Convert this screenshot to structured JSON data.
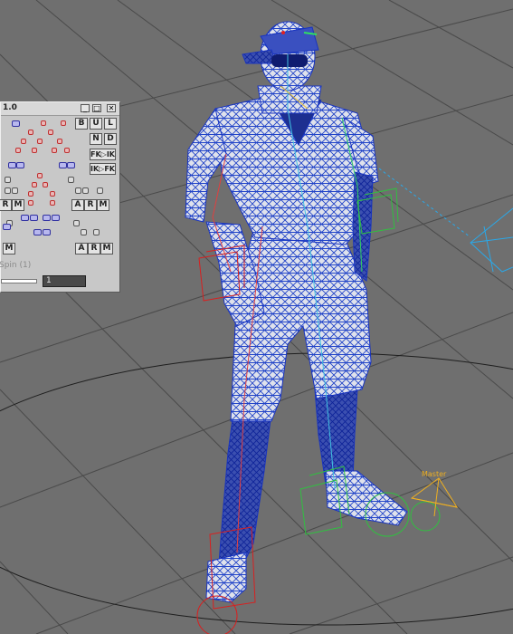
{
  "panel": {
    "title": "1.0",
    "window_buttons": {
      "minimize": "_",
      "maximize": "□",
      "close": "✕"
    },
    "top_buttons": [
      "B",
      "U",
      "L",
      "N",
      "D"
    ],
    "fk_buttons": [
      "FK▷IK",
      "IK▷FK"
    ],
    "arm_buttons_upper": [
      "A",
      "R",
      "M"
    ],
    "arm_buttons_lower": [
      "A",
      "R",
      "M"
    ],
    "left_clip_buttons": [
      "R",
      "M"
    ],
    "left_clip_letter": "M",
    "spin_label": "Spin (1)",
    "spin_value": "1"
  },
  "viewport": {
    "master_label": "Master",
    "background_color": "#6f6f6f",
    "grid_color": "#4a4a4a",
    "wire_color": "#1a3fd0",
    "mesh_color": "#e6e8ef"
  }
}
